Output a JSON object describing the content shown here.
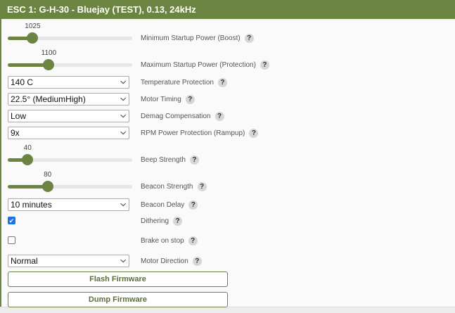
{
  "header": {
    "title": "ESC 1: G-H-30 - Bluejay (TEST), 0.13, 24kHz"
  },
  "colors": {
    "accent": "#6b8442",
    "checkbox": "#1a73e8"
  },
  "help_icon": "?",
  "settings": {
    "min_startup_power": {
      "label": "Minimum Startup Power (Boost)",
      "value": "1025",
      "level": 0.2
    },
    "max_startup_power": {
      "label": "Maximum Startup Power (Protection)",
      "value": "1100",
      "level": 0.33
    },
    "temperature_protection": {
      "label": "Temperature Protection",
      "value": "140 C"
    },
    "motor_timing": {
      "label": "Motor Timing",
      "value": "22.5° (MediumHigh)"
    },
    "demag_compensation": {
      "label": "Demag Compensation",
      "value": "Low"
    },
    "rpm_power_protection": {
      "label": "RPM Power Protection (Rampup)",
      "value": "9x"
    },
    "beep_strength": {
      "label": "Beep Strength",
      "value": "40",
      "level": 0.16
    },
    "beacon_strength": {
      "label": "Beacon Strength",
      "value": "80",
      "level": 0.32
    },
    "beacon_delay": {
      "label": "Beacon Delay",
      "value": "10 minutes"
    },
    "dithering": {
      "label": "Dithering",
      "checked": true
    },
    "brake_on_stop": {
      "label": "Brake on stop",
      "checked": false
    },
    "motor_direction": {
      "label": "Motor Direction",
      "value": "Normal"
    }
  },
  "buttons": {
    "flash": "Flash Firmware",
    "dump": "Dump Firmware"
  }
}
